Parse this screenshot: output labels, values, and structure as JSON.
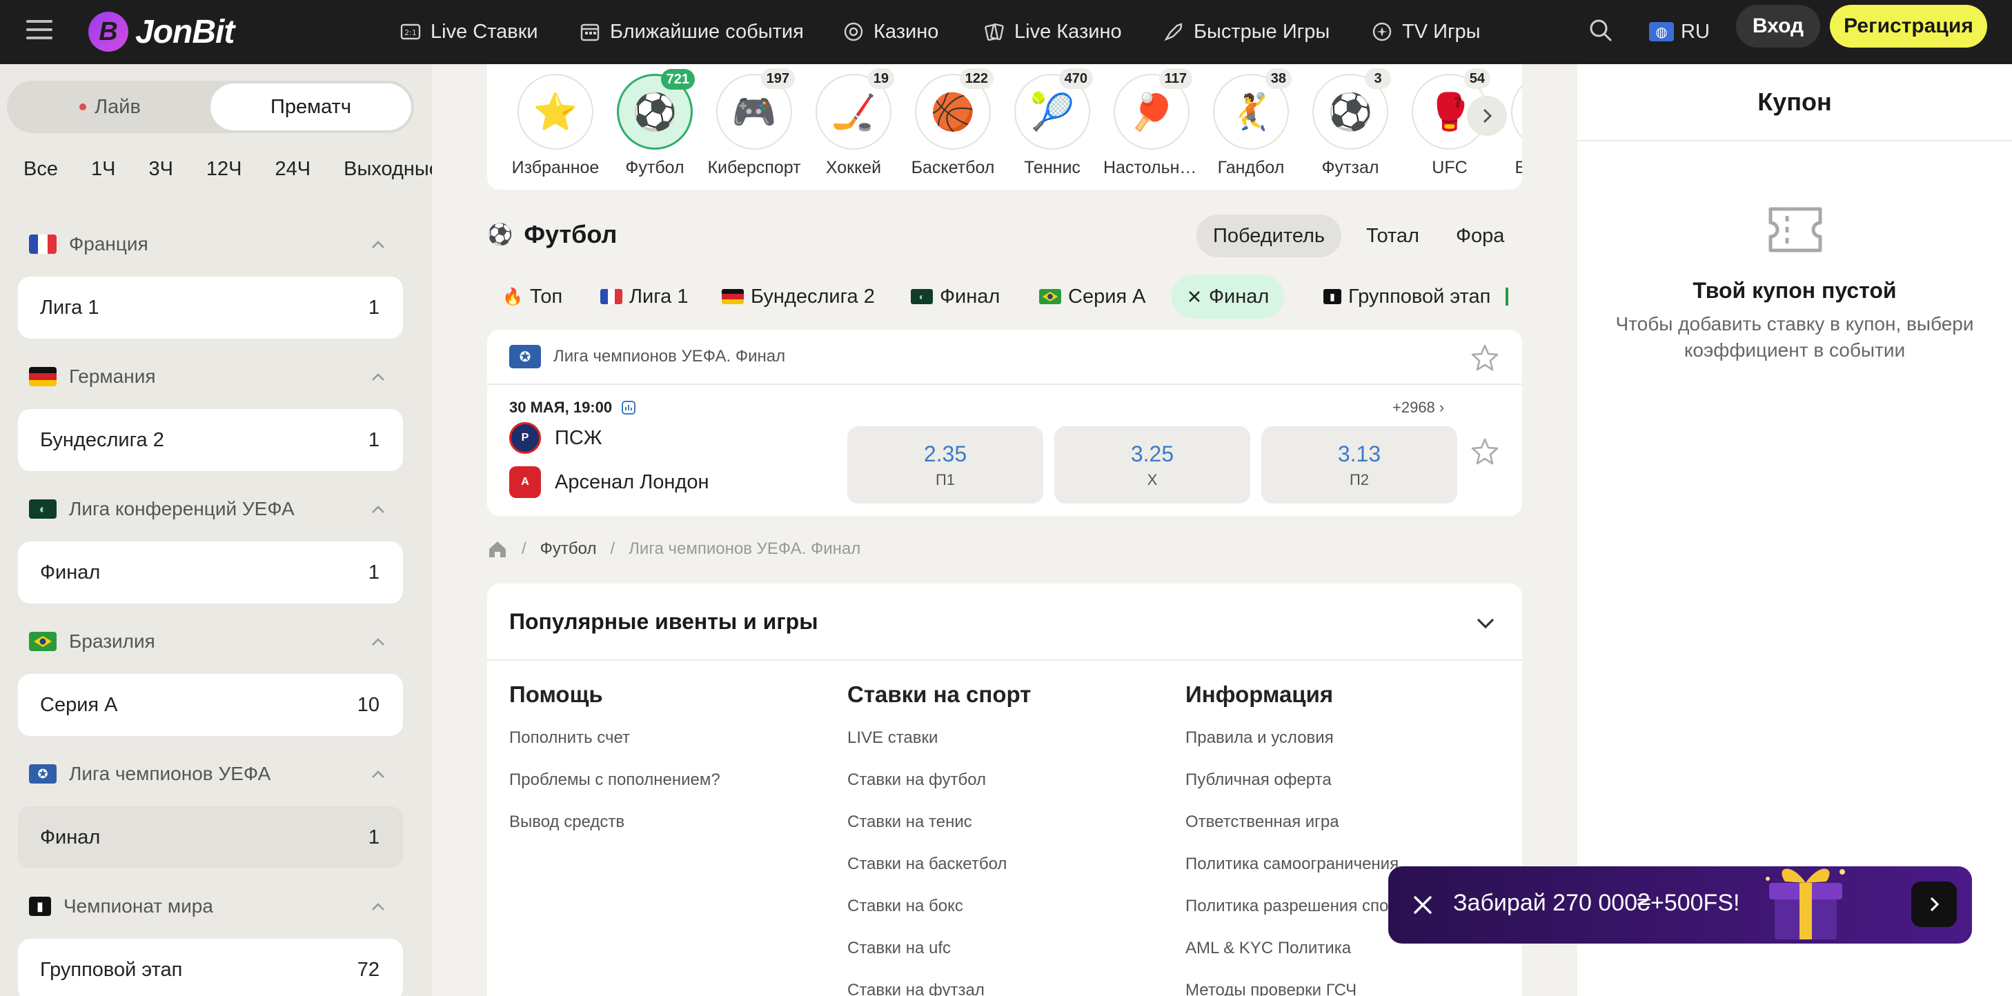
{
  "colors": {
    "accent": "#f2f551",
    "active_green": "#2fae66",
    "odds_blue": "#3b7bc7",
    "topbar": "#1d1d1d"
  },
  "header": {
    "logo": "JonBit",
    "nav": [
      {
        "label": "Live Ставки",
        "icon": "live-score-icon"
      },
      {
        "label": "Ближайшие события",
        "icon": "calendar-icon"
      },
      {
        "label": "Казино",
        "icon": "casino-chip-icon"
      },
      {
        "label": "Live Казино",
        "icon": "cards-icon"
      },
      {
        "label": "Быстрые Игры",
        "icon": "rocket-icon"
      },
      {
        "label": "TV Игры",
        "icon": "tv-games-icon"
      }
    ],
    "lang": "RU",
    "login": "Вход",
    "register": "Регистрация"
  },
  "sidebar": {
    "modes": [
      "Лайв",
      "Прематч"
    ],
    "time_filters": [
      "Все",
      "1Ч",
      "3Ч",
      "12Ч",
      "24Ч",
      "Выходные"
    ],
    "countries": [
      {
        "name": "Франция",
        "flag": "flag-france",
        "leagues": [
          {
            "name": "Лига 1",
            "count": "1"
          }
        ]
      },
      {
        "name": "Германия",
        "flag": "flag-germany",
        "leagues": [
          {
            "name": "Бундеслига 2",
            "count": "1"
          }
        ]
      },
      {
        "name": "Лига конференций УЕФА",
        "flag": "uecl-icon",
        "leagues": [
          {
            "name": "Финал",
            "count": "1"
          }
        ]
      },
      {
        "name": "Бразилия",
        "flag": "flag-brazil",
        "leagues": [
          {
            "name": "Серия А",
            "count": "10"
          }
        ]
      },
      {
        "name": "Лига чемпионов УЕФА",
        "flag": "ucl-icon",
        "leagues": [
          {
            "name": "Финал",
            "count": "1"
          }
        ]
      },
      {
        "name": "Чемпионат мира",
        "flag": "world-cup-icon",
        "leagues": [
          {
            "name": "Групповой этап",
            "count": "72"
          }
        ]
      }
    ]
  },
  "sports": [
    {
      "label": "Избранное",
      "icon": "⭐",
      "count": ""
    },
    {
      "label": "Футбол",
      "icon": "⚽",
      "count": "721"
    },
    {
      "label": "Киберспорт",
      "icon": "🎮",
      "count": "197"
    },
    {
      "label": "Хоккей",
      "icon": "🏒",
      "count": "19"
    },
    {
      "label": "Баскетбол",
      "icon": "🏀",
      "count": "122"
    },
    {
      "label": "Теннис",
      "icon": "🎾",
      "count": "470"
    },
    {
      "label": "Настольный теннис",
      "icon": "🏓",
      "count": "117"
    },
    {
      "label": "Гандбол",
      "icon": "🤾",
      "count": "38"
    },
    {
      "label": "Футзал",
      "icon": "⚽",
      "count": "3"
    },
    {
      "label": "UFC",
      "icon": "🥊",
      "count": "54"
    },
    {
      "label": "Бейсбол",
      "icon": "⚾",
      "count": ""
    }
  ],
  "section": {
    "title": "Футбол",
    "markets": [
      "Победитель",
      "Тотал",
      "Фора"
    ]
  },
  "chips": [
    {
      "label": "Топ",
      "icon": "fire-icon"
    },
    {
      "label": "Лига 1",
      "icon": "flag-france"
    },
    {
      "label": "Бундеслига 2",
      "icon": "flag-germany"
    },
    {
      "label": "Финал",
      "icon": "uecl-icon"
    },
    {
      "label": "Серия А",
      "icon": "flag-brazil"
    },
    {
      "label": "Финал",
      "icon": "close-icon"
    },
    {
      "label": "Групповой этап",
      "icon": "world-cup-icon"
    }
  ],
  "event": {
    "league": "Лига чемпионов УЕФА. Финал",
    "date": "30 МАЯ, 19:00",
    "more": "+2968",
    "team1": "ПСЖ",
    "team2": "Арсенал Лондон",
    "odds": [
      {
        "value": "2.35",
        "label": "П1"
      },
      {
        "value": "3.25",
        "label": "Х"
      },
      {
        "value": "3.13",
        "label": "П2"
      }
    ]
  },
  "breadcrumb": {
    "sport": "Футбол",
    "current": "Лига чемпионов УЕФА. Финал",
    "sep": "/"
  },
  "footer": {
    "popular": "Популярные ивенты и игры",
    "columns": [
      {
        "title": "Помощь",
        "links": [
          "Пополнить счет",
          "Проблемы с пополнением?",
          "Вывод средств"
        ]
      },
      {
        "title": "Ставки на спорт",
        "links": [
          "LIVE ставки",
          "Ставки на футбол",
          "Ставки на тенис",
          "Ставки на баскетбол",
          "Ставки на бокс",
          "Ставки на ufc",
          "Ставки на футзал"
        ]
      },
      {
        "title": "Информация",
        "links": [
          "Правила и условия",
          "Публичная оферта",
          "Ответственная игра",
          "Политика самоограничения",
          "Политика разрешения споров",
          "AML & KYC Политика",
          "Методы проверки ГСЧ"
        ]
      }
    ]
  },
  "coupon": {
    "title": "Купон",
    "empty": "Твой купон пустой",
    "hint": "Чтобы добавить ставку в купон, выбери коэффициент в событии"
  },
  "promo": {
    "text": "Забирай 270 000₴+500FS!"
  }
}
